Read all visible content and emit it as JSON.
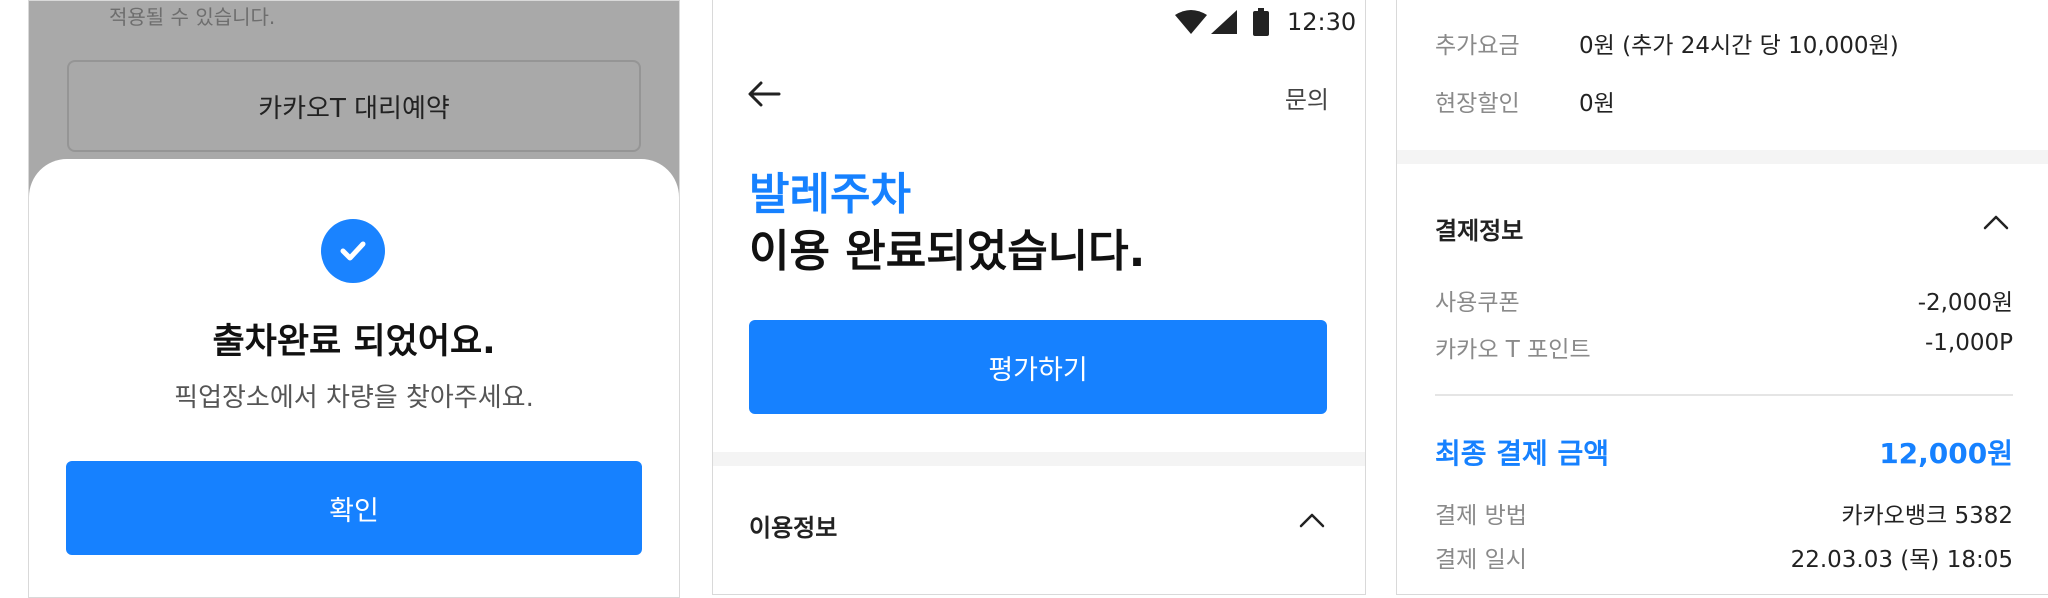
{
  "panel1": {
    "dim_text": "적용될 수 있습니다.",
    "dim_button": "카카오T 대리예약",
    "check_icon": "check-circle-icon",
    "title": "출차완료 되었어요.",
    "subtitle": "픽업장소에서 차량을 찾아주세요.",
    "confirm": "확인"
  },
  "panel2": {
    "time": "12:30",
    "inquiry": "문의",
    "title_blue": "발레주차",
    "title_black": "이용 완료되었습니다.",
    "rate_button": "평가하기",
    "usage_info": "이용정보"
  },
  "panel3": {
    "extra_fee_label": "추가요금",
    "extra_fee_value": "0원 (추가 24시간 당 10,000원)",
    "onsite_discount_label": "현장할인",
    "onsite_discount_value": "0원",
    "payment_info": "결제정보",
    "coupon_label": "사용쿠폰",
    "coupon_value": "-2,000원",
    "point_label": "카카오 T 포인트",
    "point_value": "-1,000P",
    "final_label": "최종 결제 금액",
    "final_value": "12,000원",
    "method_label": "결제 방법",
    "method_value": "카카오뱅크 5382",
    "date_label": "결제 일시",
    "date_value": "22.03.03 (목) 18:05"
  },
  "colors": {
    "accent": "#1681ff",
    "dim": "#a9a9a9"
  }
}
